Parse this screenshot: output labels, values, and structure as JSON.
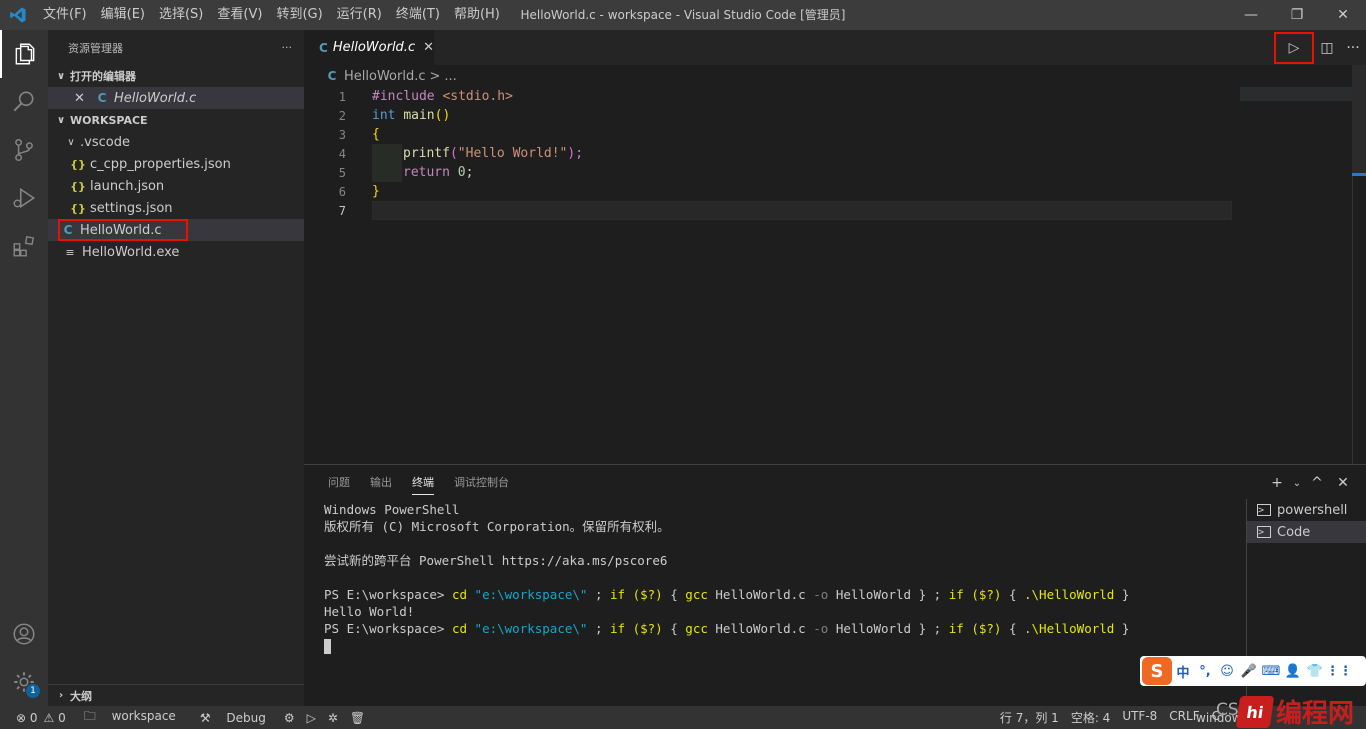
{
  "titlebar": {
    "menu": [
      "文件(F)",
      "编辑(E)",
      "选择(S)",
      "查看(V)",
      "转到(G)",
      "运行(R)",
      "终端(T)",
      "帮助(H)"
    ],
    "title": "HelloWorld.c - workspace - Visual Studio Code [管理员]",
    "minimize": "—",
    "restore": "❐",
    "close": "✕"
  },
  "activitybar": {
    "items": [
      "files-icon",
      "search-icon",
      "source-control-icon",
      "run-debug-icon",
      "extensions-icon"
    ],
    "bottom": [
      "account-icon",
      "settings-gear-icon"
    ],
    "settings_badge": "1"
  },
  "sidebar": {
    "title": "资源管理器",
    "more": "···",
    "open_editors_label": "打开的编辑器",
    "open_editors": [
      {
        "name": "HelloWorld.c",
        "close": "✕",
        "icon": "C"
      }
    ],
    "workspace_label": "WORKSPACE",
    "folder": ".vscode",
    "files_in_folder": [
      {
        "name": "c_cpp_properties.json",
        "icon": "{}"
      },
      {
        "name": "launch.json",
        "icon": "{}"
      },
      {
        "name": "settings.json",
        "icon": "{}"
      }
    ],
    "files": [
      {
        "name": "HelloWorld.c",
        "icon": "C"
      },
      {
        "name": "HelloWorld.exe",
        "icon": "≡"
      }
    ],
    "outline_label": "大纲"
  },
  "editor": {
    "tab": {
      "label": "HelloWorld.c",
      "icon": "C",
      "close": "✕"
    },
    "breadcrumb": {
      "file": "HelloWorld.c",
      "sep": ">",
      "rest": "..."
    },
    "actions": {
      "run": "▷",
      "split": "◫",
      "more": "···"
    },
    "line_numbers": [
      "1",
      "2",
      "3",
      "4",
      "5",
      "6",
      "7"
    ],
    "code": {
      "l1_directive": "#include",
      "l1_header": "<stdio.h>",
      "l2_type": "int",
      "l2_name": "main",
      "l2_parens": "()",
      "l3": "{",
      "l4_fn": "printf",
      "l4_open": "(",
      "l4_str": "\"Hello World!\"",
      "l4_close": ");",
      "l5_kw": "return",
      "l5_num": "0",
      "l5_semi": ";",
      "l6": "}"
    }
  },
  "panel": {
    "tabs": [
      "问题",
      "输出",
      "终端",
      "调试控制台"
    ],
    "active_tab": "终端",
    "actions": {
      "add": "+",
      "dropdown": "⌄",
      "maximize": "^",
      "close": "✕"
    },
    "terminal": {
      "line1": "Windows PowerShell",
      "line2": "版权所有 (C) Microsoft Corporation。保留所有权利。",
      "line3": "",
      "line4": "尝试新的跨平台 PowerShell https://aka.ms/pscore6",
      "line5": "",
      "prompt": "PS E:\\workspace>",
      "cmd_cd": "cd",
      "cmd_path": "\"e:\\workspace\\\"",
      "cmd_semi1": " ; ",
      "cmd_if": "if",
      "cmd_cond": "($?)",
      "cmd_ob": " { ",
      "cmd_gcc": "gcc",
      "cmd_file": " HelloWorld.c ",
      "cmd_o": "-o",
      "cmd_out": " HelloWorld } ",
      "cmd_semi2": "; ",
      "cmd_run": ".\\HelloWorld",
      "cmd_cb": " }",
      "output": "Hello World!"
    },
    "terminal_list": [
      "powershell",
      "Code"
    ]
  },
  "statusbar": {
    "errors": "⊗ 0",
    "warnings": "⚠ 0",
    "workspace": "workspace",
    "debug": "Debug",
    "position": "行 7，列 1",
    "spaces": "空格: 4",
    "encoding": "UTF-8",
    "eol": "CRLF",
    "language": "C",
    "platform": "window"
  },
  "ime": {
    "logo": "S",
    "items": [
      "中",
      "°,",
      "☺",
      "🎤",
      "⌨",
      "👤",
      "👕",
      "⋮⋮"
    ]
  },
  "watermark": {
    "logo": "hi",
    "text": "编程网",
    "cs": "CS"
  },
  "colors": {
    "accent": "#007acc",
    "highlight": "#e51400",
    "titlebar": "#3c3c3c"
  }
}
